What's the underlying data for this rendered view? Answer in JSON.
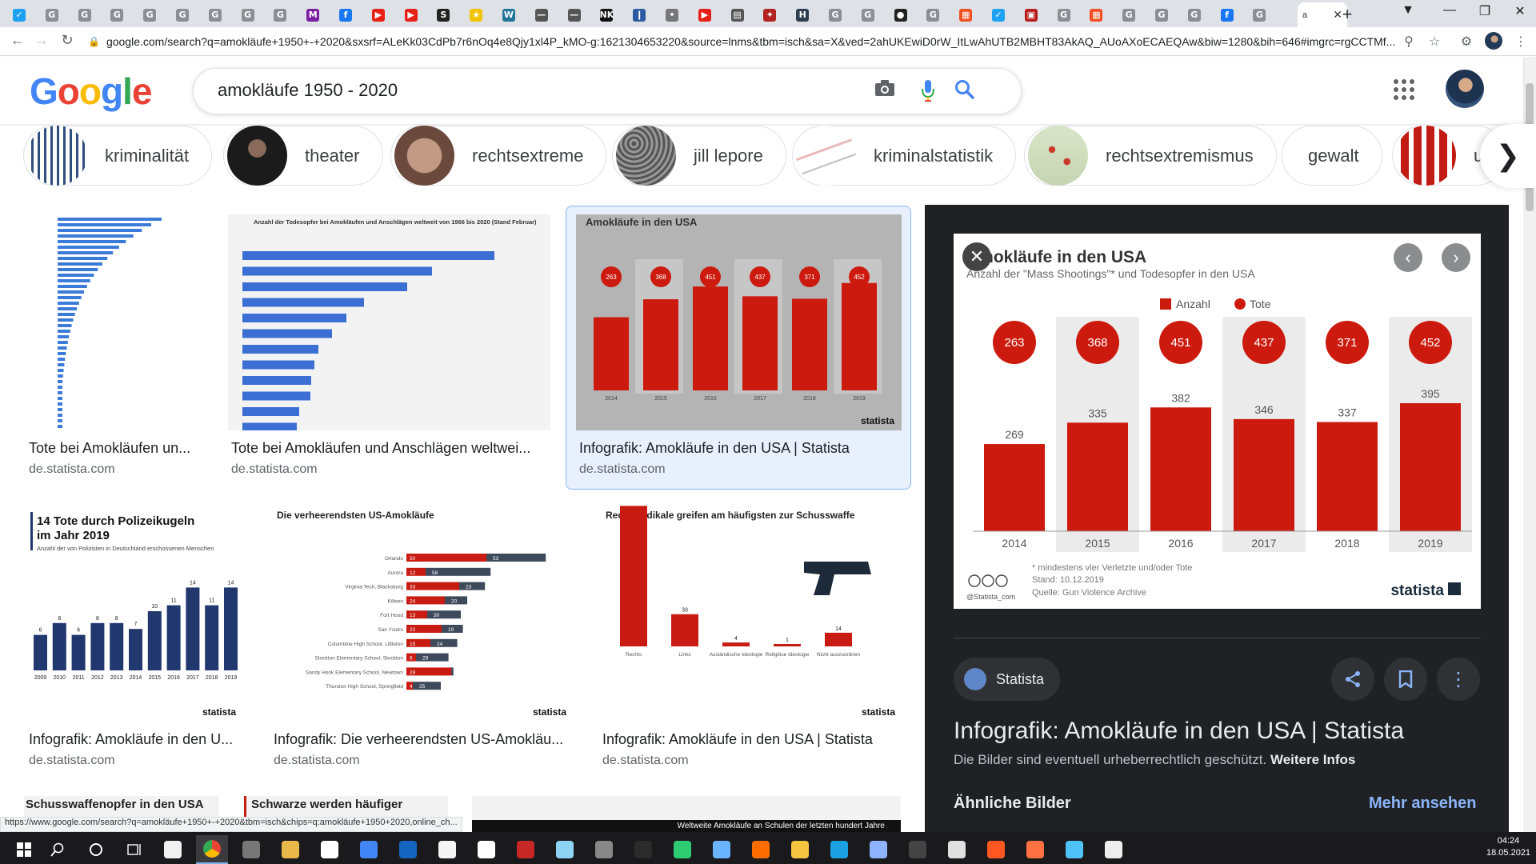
{
  "browser": {
    "url": "google.com/search?q=amokläufe+1950+-+2020&sxsrf=ALeKk03CdPb7r6nOq4e8Qjy1xl4P_kMO-g:1621304653220&source=lnms&tbm=isch&sa=X&ved=2ahUKEwiD0rW_ItLwAhUTB2MBHT83AkAQ_AUoAXoECAEQAw&biw=1280&bih=646#imgrc=rgCCTMf...",
    "tabs": [
      {
        "glyph": "✓",
        "color": "#1da1f2"
      },
      {
        "glyph": "G",
        "color": "#8a8f96"
      },
      {
        "glyph": "G",
        "color": "#8a8f96"
      },
      {
        "glyph": "G",
        "color": "#8a8f96"
      },
      {
        "glyph": "G",
        "color": "#8a8f96"
      },
      {
        "glyph": "G",
        "color": "#8a8f96"
      },
      {
        "glyph": "G",
        "color": "#8a8f96"
      },
      {
        "glyph": "G",
        "color": "#8a8f96"
      },
      {
        "glyph": "G",
        "color": "#8a8f96"
      },
      {
        "glyph": "M",
        "color": "#7b1fa2"
      },
      {
        "glyph": "f",
        "color": "#1877f2"
      },
      {
        "glyph": "▶",
        "color": "#e62117"
      },
      {
        "glyph": "▶",
        "color": "#e62117"
      },
      {
        "glyph": "S",
        "color": "#222"
      },
      {
        "glyph": "★",
        "color": "#f2c400"
      },
      {
        "glyph": "W",
        "color": "#21759b"
      },
      {
        "glyph": "—",
        "color": "#555"
      },
      {
        "glyph": "—",
        "color": "#555"
      },
      {
        "glyph": "NK",
        "color": "#111"
      },
      {
        "glyph": "❙",
        "color": "#2c5aa0"
      },
      {
        "glyph": "•",
        "color": "#777"
      },
      {
        "glyph": "▶",
        "color": "#e62117"
      },
      {
        "glyph": "▤",
        "color": "#555"
      },
      {
        "glyph": "✦",
        "color": "#b22222"
      },
      {
        "glyph": "H",
        "color": "#2c3e50"
      },
      {
        "glyph": "G",
        "color": "#8a8f96"
      },
      {
        "glyph": "G",
        "color": "#8a8f96"
      },
      {
        "glyph": "●",
        "color": "#222"
      },
      {
        "glyph": "G",
        "color": "#8a8f96"
      },
      {
        "glyph": "▦",
        "color": "#f25022"
      },
      {
        "glyph": "✓",
        "color": "#1da1f2"
      },
      {
        "glyph": "▣",
        "color": "#b71c1c"
      },
      {
        "glyph": "G",
        "color": "#8a8f96"
      },
      {
        "glyph": "▦",
        "color": "#f25022"
      },
      {
        "glyph": "G",
        "color": "#8a8f96"
      },
      {
        "glyph": "G",
        "color": "#8a8f96"
      },
      {
        "glyph": "G",
        "color": "#8a8f96"
      },
      {
        "glyph": "f",
        "color": "#1877f2"
      },
      {
        "glyph": "G",
        "color": "#8a8f96"
      }
    ],
    "active_tab_label": "a",
    "status_url": "https://www.google.com/search?q=amokläufe+1950+-+2020&tbm=isch&chips=q:amokläufe+1950+2020,online_ch..."
  },
  "google": {
    "logo": [
      "G",
      "o",
      "o",
      "g",
      "l",
      "e"
    ],
    "logo_colors": [
      "#4285f4",
      "#ea4335",
      "#fbbc05",
      "#4285f4",
      "#34a853",
      "#ea4335"
    ],
    "query": "amokläufe 1950 - 2020"
  },
  "chips": [
    {
      "label": "kriminalität",
      "thumb": "bars"
    },
    {
      "label": "theater",
      "thumb": "dark"
    },
    {
      "label": "rechtsextreme",
      "thumb": "face"
    },
    {
      "label": "jill lepore",
      "thumb": "crowd"
    },
    {
      "label": "kriminalstatistik",
      "thumb": "lines"
    },
    {
      "label": "rechtsextremismus",
      "thumb": "map"
    },
    {
      "label": "gewalt",
      "thumb": "none"
    },
    {
      "label": "u",
      "thumb": "redbars"
    }
  ],
  "results": [
    {
      "title": "Tote bei Amokläufen un...",
      "source": "de.statista.com"
    },
    {
      "title": "Tote bei Amokläufen und Anschlägen weltwei...",
      "source": "de.statista.com",
      "img_title": "Anzahl der Todesopfer bei Amokläufen und Anschlägen weltweit von 1966 bis 2020 (Stand Februar)"
    },
    {
      "title": "Infografik: Amokläufe in den USA | Statista",
      "source": "de.statista.com",
      "img_title": "Amokläufe in den USA"
    },
    {
      "title": "Infografik: Amokläufe in den U...",
      "source": "de.statista.com",
      "img_title": "14 Tote durch Polizeikugeln im Jahr 2019",
      "img_sub": "Anzahl der von Polizisten in Deutschland erschossenen Menschen",
      "img_years": [
        "2009",
        "2010",
        "2011",
        "2012",
        "2013",
        "2014",
        "2015",
        "2016",
        "2017",
        "2018",
        "2019"
      ],
      "img_values": [
        "6",
        "8",
        "6",
        "8",
        "8",
        "7",
        "10",
        "11",
        "14",
        "11",
        "14"
      ]
    },
    {
      "title": "Infografik: Die verheerendsten US-Amokläu...",
      "source": "de.statista.com",
      "img_title": "Die verheerendsten US-Amokläufe",
      "img_places": [
        "Orlando",
        "Aurora",
        "Virginia Tech, Blacksburg",
        "Killeen",
        "Fort Hood",
        "San Ysidro",
        "Columbine High School, Littleton",
        "Stockton Elementary School, Stockton",
        "Sandy Hook Elementary School, Newtown",
        "Thurston High School, Springfield"
      ],
      "img_dead": [
        "50",
        "12",
        "33",
        "24",
        "13",
        "22",
        "15",
        "6",
        "28",
        "4"
      ],
      "img_injured": [
        "53",
        "58",
        "23",
        "20",
        "30",
        "19",
        "24",
        "29",
        "2",
        "25"
      ]
    },
    {
      "title": "Infografik: Amokläufe in den USA | Statista",
      "source": "de.statista.com",
      "img_title": "Rechtsradikale greifen am häufigsten zur Schusswaffe",
      "img_cats": [
        "Rechts",
        "Links",
        "Ausländische Ideologie",
        "Religiöse Ideologie",
        "Nicht auszuordnen"
      ],
      "img_values": [
        "144",
        "33",
        "4",
        "1",
        "14"
      ]
    }
  ],
  "partial_results": [
    "Schusswaffenopfer in den USA",
    "Schwarze werden häufiger",
    "Weltweite Amokläufe an Schulen der letzten hundert Jahre"
  ],
  "side_panel": {
    "chart_title": "Amokläufe in den USA",
    "chart_subtitle": "Anzahl der \"Mass Shootings\"* und Todesopfer in den USA",
    "legend_count": "Anzahl",
    "legend_dead": "Tote",
    "footnote": "* mindestens vier Verletzte und/oder Tote",
    "stand": "Stand: 10.12.2019",
    "quelle": "Quelle: Gun Violence Archive",
    "handle": "@Statista_com",
    "brand": "statista",
    "source_name": "Statista",
    "title": "Infografik: Amokläufe in den USA | Statista",
    "copyright": "Die Bilder sind eventuell urheberrechtlich geschützt.",
    "more_info": "Weitere Infos",
    "similar_heading": "Ähnliche Bilder",
    "more_link": "Mehr ansehen"
  },
  "chart_data": {
    "type": "bar",
    "title": "Amokläufe in den USA",
    "subtitle": "Anzahl der \"Mass Shootings\"* und Todesopfer in den USA",
    "categories": [
      "2014",
      "2015",
      "2016",
      "2017",
      "2018",
      "2019"
    ],
    "series": [
      {
        "name": "Anzahl",
        "values": [
          269,
          335,
          382,
          346,
          337,
          395
        ]
      },
      {
        "name": "Tote",
        "values": [
          263,
          368,
          451,
          437,
          371,
          452
        ]
      }
    ],
    "ylim": [
      0,
      400
    ],
    "legend": "top-center",
    "colors": {
      "bar": "#cc1a0e",
      "alt_band": "#ebebeb"
    }
  },
  "taskbar": {
    "time": "04:24",
    "date": "18.05.2021",
    "apps": [
      "#f2f2f2",
      "#555",
      "#777",
      "#e8b84a",
      "#ffffff",
      "#4285f4",
      "#1565c0",
      "#f5f5f5",
      "#ffffff",
      "#c62828",
      "#8fd3f4",
      "#888",
      "#2b2b2b",
      "#2ecc71",
      "#6ab4ff",
      "#ff6d00",
      "#f5c542",
      "#1ba1e2",
      "#8fb2ff",
      "#444",
      "#e0e0e0",
      "#ff5722",
      "#ff7043",
      "#4fc3f7",
      "#eeeeee"
    ]
  }
}
